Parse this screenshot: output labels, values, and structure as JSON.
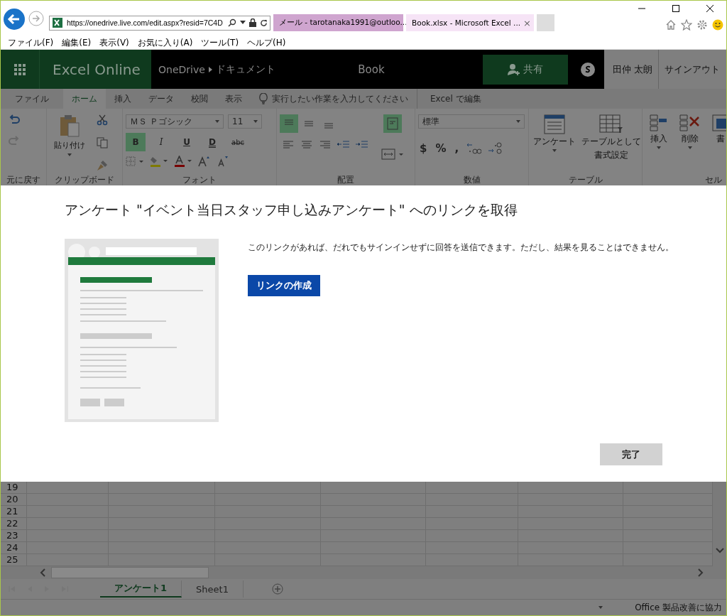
{
  "browser": {
    "url": "https://onedrive.live.com/edit.aspx?resid=7C4D",
    "tabs": [
      {
        "kind": "outlook",
        "title": "メール - tarotanaka1991@outloo...",
        "selected": false
      },
      {
        "kind": "excel",
        "title": "Book.xlsx - Microsoft Excel ...",
        "selected": true
      }
    ],
    "close_tab": "×",
    "menu": [
      "ファイル(F)",
      "編集(E)",
      "表示(V)",
      "お気に入り(A)",
      "ツール(T)",
      "ヘルプ(H)"
    ]
  },
  "header": {
    "brand": "Excel Online",
    "breadcrumb": [
      "OneDrive",
      "ドキュメント"
    ],
    "doc_title": "Book",
    "share": "共有",
    "user": "田仲 太朗",
    "signout": "サインアウト"
  },
  "ribbon_tabs": [
    {
      "label": "ファイル",
      "selected": false
    },
    {
      "label": "ホーム",
      "selected": true
    },
    {
      "label": "挿入",
      "selected": false
    },
    {
      "label": "データ",
      "selected": false
    },
    {
      "label": "校閲",
      "selected": false
    },
    {
      "label": "表示",
      "selected": false
    }
  ],
  "tell_me": "実行したい作業を入力してください",
  "edit_in": "Excel で編集",
  "ribbon": {
    "paste": "貼り付け",
    "font_name": "ＭＳ Ｐゴシック",
    "font_size": "11",
    "font_buttons": [
      {
        "label": "B",
        "on": true
      },
      {
        "label": "I",
        "on": false
      },
      {
        "label": "U",
        "on": false
      },
      {
        "label": "D",
        "on": false
      },
      {
        "label": "abc",
        "on": false
      }
    ],
    "align_top_on": true,
    "wrap_on": true,
    "number_format": "標準",
    "number_buttons": [
      "$",
      "%",
      ","
    ],
    "survey": "アンケート",
    "format_table": [
      "テーブルとして",
      "書式設定"
    ],
    "insert": "挿入",
    "delete": "削除",
    "format_cut": "書",
    "groups": [
      "元に戻す",
      "クリップボード",
      "フォント",
      "配置",
      "数値",
      "テーブル",
      "セル"
    ]
  },
  "dialog": {
    "title": "アンケート \"イベント当日スタッフ申し込みアンケート\" へのリンクを取得",
    "text": "このリンクがあれば、だれでもサインインせずに回答を送信できます。ただし、結果を見ることはできません。",
    "create_button": "リンクの作成",
    "done_button": "完了"
  },
  "grid": {
    "rows": [
      "19",
      "20",
      "21",
      "22",
      "23",
      "24",
      "25"
    ]
  },
  "sheets": [
    {
      "label": "アンケート1",
      "selected": true
    },
    {
      "label": "Sheet1",
      "selected": false
    }
  ],
  "status_bar": "Office 製品改善に協力"
}
